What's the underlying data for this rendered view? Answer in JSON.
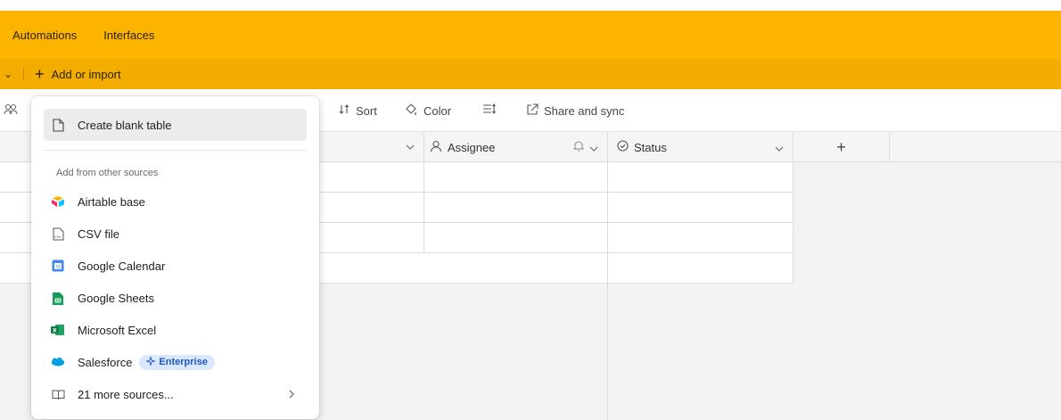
{
  "topbar": {
    "automations": "Automations",
    "interfaces": "Interfaces"
  },
  "subbar": {
    "chevron": "⌄",
    "plus": "+",
    "add_label": "Add or import"
  },
  "toolbar": {
    "sort": "Sort",
    "color": "Color",
    "share": "Share and sync"
  },
  "grid": {
    "columns": {
      "assignee": "Assignee",
      "status": "Status",
      "add": "+"
    }
  },
  "menu": {
    "create_blank": "Create blank table",
    "section_label": "Add from other sources",
    "items": [
      {
        "label": "Airtable base",
        "icon": "airtable-icon"
      },
      {
        "label": "CSV file",
        "icon": "csv-file-icon"
      },
      {
        "label": "Google Calendar",
        "icon": "google-calendar-icon"
      },
      {
        "label": "Google Sheets",
        "icon": "google-sheets-icon"
      },
      {
        "label": "Microsoft Excel",
        "icon": "microsoft-excel-icon"
      },
      {
        "label": "Salesforce",
        "icon": "salesforce-icon"
      }
    ],
    "badge": "Enterprise",
    "more": "21 more sources..."
  },
  "colors": {
    "topbar": "#fcb400",
    "subbar": "#f2ad00",
    "badge_bg": "#d9e8ff",
    "badge_text": "#1a56c4"
  }
}
